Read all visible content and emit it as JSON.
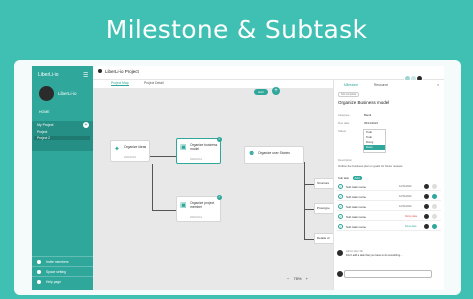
{
  "banner": {
    "title": "Milestone & Subtask"
  },
  "colors": {
    "accent": "#2fa79b",
    "background": "#3fc0b3"
  },
  "sidebar": {
    "logo": "LiberLi-io",
    "user": "LiberLi-io",
    "home": "HOME",
    "section_title": "My Project",
    "projects": [
      "Project",
      "Project 2"
    ],
    "bottom": [
      "Invite members",
      "Space setting",
      "Help page"
    ]
  },
  "topbar": {
    "project_title": "LiberLi-io Project"
  },
  "tabs": [
    "Project Map",
    "Project Detail"
  ],
  "canvas": {
    "edit_label": "Edit",
    "zoom_minus": "−",
    "zoom_value": "75%",
    "zoom_plus": "+",
    "nodes": [
      {
        "label": "Organize ideas",
        "meta": "2022/12/12",
        "icon": "bulb-icon"
      },
      {
        "label": "Organize business model",
        "meta": "2022/12/12",
        "icon": "briefcase-icon"
      },
      {
        "label": "Organize user Stories",
        "meta": "",
        "icon": "users-icon"
      },
      {
        "label": "Organize project member",
        "meta": "2022/12/12",
        "icon": "group-icon"
      }
    ],
    "stubs": [
      "Structure",
      "Prototype",
      "Details of"
    ]
  },
  "panel": {
    "tabs": [
      "Milestone",
      "Resource"
    ],
    "badge": "Not complete",
    "title": "Organize Business model",
    "fields": [
      {
        "label": "Assignee",
        "value": "Bandi"
      },
      {
        "label": "Due date",
        "value": "09/12/2022"
      },
      {
        "label": "Status",
        "value": "Todo"
      }
    ],
    "status_options": [
      "Todo",
      "Doing",
      "Done"
    ],
    "description_label": "Description",
    "description_text": "Outline the business plan or goals for future reviews",
    "subtask_label": "Sub task",
    "subtask_add": "Add",
    "subtasks": [
      {
        "name": "Sub task name",
        "date": "12/31/2022",
        "status": ""
      },
      {
        "name": "Sub task name",
        "date": "12/31/2022",
        "status": ""
      },
      {
        "name": "Sub task name",
        "date": "12/31/2022",
        "status": ""
      },
      {
        "name": "Sub task name",
        "date": "",
        "status": "Doing date"
      },
      {
        "name": "Sub task name",
        "date": "",
        "status": "Done date"
      }
    ],
    "comment_name": "Admin  Dec 3th",
    "comment_text": "Don't add a task that you have to do something..."
  }
}
